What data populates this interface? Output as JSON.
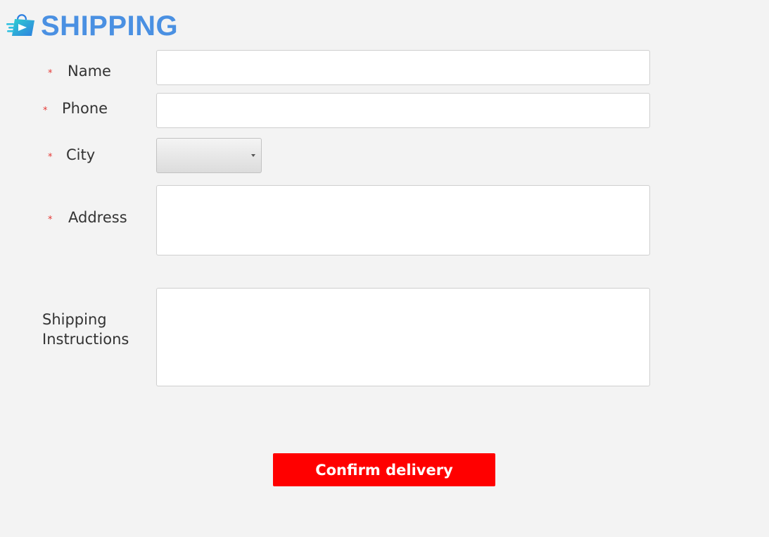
{
  "header": {
    "logo_icon": "shopping-bag-arrow-icon",
    "title": "SHIPPING",
    "title_color": "#4a90e2"
  },
  "form": {
    "required_marker": "*",
    "required_color": "#e53935",
    "name": {
      "label": "Name",
      "value": ""
    },
    "phone": {
      "label": "Phone",
      "value": ""
    },
    "city": {
      "label": "City",
      "selected": ""
    },
    "address": {
      "label": "Address",
      "value": ""
    },
    "instructions": {
      "label": "Shipping Instructions",
      "value": ""
    }
  },
  "actions": {
    "confirm_label": "Confirm delivery",
    "confirm_color": "#ff0000"
  }
}
